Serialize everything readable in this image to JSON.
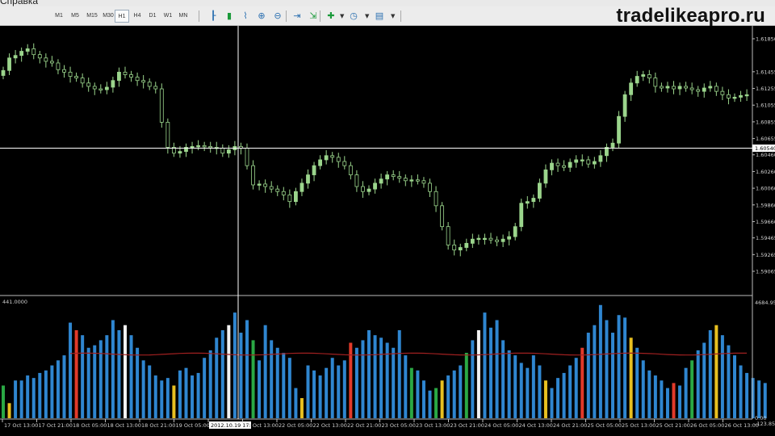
{
  "menu": {
    "partial_label": "Справка"
  },
  "watermark": "tradelikeapro.ru",
  "toolbar": {
    "timeframes": [
      "M1",
      "M5",
      "M15",
      "M30",
      "H1",
      "H4",
      "D1",
      "W1",
      "MN"
    ],
    "active_timeframe": "H1",
    "icons": [
      "bar-chart-icon",
      "candlestick-chart-icon",
      "line-chart-icon",
      "zoom-in-icon",
      "zoom-out-icon",
      "chart-shift-icon",
      "autoscroll-icon",
      "indicators-icon",
      "periods-icon",
      "templates-icon"
    ]
  },
  "colors": {
    "background": "#000000",
    "candle_up": "#9bd58c",
    "candle_down": "#000000",
    "candle_wick": "#9bd58c",
    "grid_frame": "#bdbdbd",
    "crosshair": "#ffffff",
    "volume_blue": "#2f86d0",
    "volume_red": "#e23a2a",
    "volume_green": "#2aa844",
    "volume_white": "#f2f2f2",
    "volume_yellow": "#e8c020",
    "volume_ma": "#a02020"
  },
  "price_axis": {
    "ticks": [
      "1.61850",
      "1.61455",
      "1.61255",
      "1.61055",
      "1.60855",
      "1.60655",
      "1.60540",
      "1.60460",
      "1.60260",
      "1.60060",
      "1.59860",
      "1.59660",
      "1.59465",
      "1.59265",
      "1.59065"
    ],
    "crosshair_label": "1.60540"
  },
  "volume_panel": {
    "left_label": "441.0000",
    "top_label": "4684.95",
    "bottom_labels": [
      "0.00",
      "-123.85"
    ]
  },
  "time_axis": {
    "labels": [
      "17 Oct 13:00",
      "17 Oct 21:00",
      "18 Oct 05:00",
      "18 Oct 13:00",
      "18 Oct 21:00",
      "19 Oct 05:00",
      "2012.10.19 17:00",
      "20 Oct 13:00",
      "22 Oct 05:00",
      "22 Oct 13:00",
      "22 Oct 21:00",
      "23 Oct 05:00",
      "23 Oct 13:00",
      "23 Oct 21:00",
      "24 Oct 05:00",
      "24 Oct 13:00",
      "24 Oct 21:00",
      "25 Oct 05:00",
      "25 Oct 13:00",
      "25 Oct 21:00",
      "26 Oct 05:00",
      "26 Oct 13:00"
    ],
    "highlighted_label": "2012.10.19 17:00"
  },
  "chart_data": {
    "type": "candlestick",
    "timeframe": "H1",
    "price_range": [
      1.59065,
      1.6185
    ],
    "crosshair_price": 1.6054,
    "close_series": [
      1.6147,
      1.6162,
      1.6165,
      1.617,
      1.6173,
      1.6166,
      1.6162,
      1.6158,
      1.6156,
      1.6148,
      1.6145,
      1.614,
      1.6138,
      1.6132,
      1.6128,
      1.6125,
      1.6124,
      1.6127,
      1.6135,
      1.6145,
      1.6142,
      1.6139,
      1.6135,
      1.6133,
      1.6128,
      1.6125,
      1.6085,
      1.6055,
      1.6048,
      1.605,
      1.6055,
      1.6056,
      1.6057,
      1.6056,
      1.6055,
      1.6054,
      1.6048,
      1.6052,
      1.6056,
      1.6054,
      1.6033,
      1.601,
      1.6011,
      1.6008,
      1.6005,
      1.6002,
      1.5998,
      1.599,
      1.6002,
      1.6012,
      1.6022,
      1.6033,
      1.604,
      1.6045,
      1.6043,
      1.6038,
      1.6033,
      1.6022,
      1.6008,
      1.6002,
      1.6005,
      1.6012,
      1.6017,
      1.6022,
      1.602,
      1.6018,
      1.6015,
      1.6016,
      1.6015,
      1.6012,
      1.6002,
      1.5985,
      1.596,
      1.5938,
      1.5932,
      1.5935,
      1.594,
      1.5945,
      1.5946,
      1.5946,
      1.5944,
      1.5942,
      1.5945,
      1.5948,
      1.596,
      1.5988,
      1.599,
      1.5994,
      1.6012,
      1.6028,
      1.6036,
      1.6033,
      1.6031,
      1.6037,
      1.604,
      1.604,
      1.6035,
      1.6038,
      1.6045,
      1.6055,
      1.606,
      1.6092,
      1.6118,
      1.6132,
      1.614,
      1.6142,
      1.6138,
      1.6128,
      1.6126,
      1.6128,
      1.6125,
      1.6128,
      1.6126,
      1.6124,
      1.6122,
      1.6126,
      1.6128,
      1.6122,
      1.6118,
      1.6114,
      1.6115,
      1.6117,
      1.6118
    ],
    "volume_range": [
      0,
      4684.95
    ],
    "volume_colors": [
      "green",
      "yellow",
      "blue",
      "blue",
      "blue",
      "blue",
      "blue",
      "blue",
      "blue",
      "blue",
      "blue",
      "blue",
      "red",
      "blue",
      "blue",
      "blue",
      "blue",
      "blue",
      "blue",
      "blue",
      "white",
      "blue",
      "blue",
      "blue",
      "blue",
      "blue",
      "blue",
      "blue",
      "yellow",
      "blue",
      "blue",
      "blue",
      "blue",
      "blue",
      "blue",
      "blue",
      "blue",
      "white",
      "blue",
      "blue",
      "blue",
      "green",
      "blue",
      "blue",
      "blue",
      "blue",
      "blue",
      "blue",
      "blue",
      "yellow",
      "blue",
      "blue",
      "blue",
      "blue",
      "blue",
      "blue",
      "blue",
      "red",
      "blue",
      "blue",
      "blue",
      "blue",
      "blue",
      "blue",
      "blue",
      "blue",
      "blue",
      "green",
      "blue",
      "blue",
      "blue",
      "green",
      "yellow",
      "blue",
      "blue",
      "blue",
      "green",
      "blue",
      "white",
      "blue",
      "blue",
      "blue",
      "blue",
      "blue",
      "blue",
      "blue",
      "blue",
      "blue",
      "blue",
      "yellow",
      "blue",
      "blue",
      "blue",
      "blue",
      "blue",
      "red",
      "blue",
      "blue",
      "blue",
      "blue",
      "blue",
      "blue",
      "blue",
      "yellow",
      "blue",
      "blue",
      "blue",
      "blue",
      "blue",
      "blue",
      "red",
      "blue",
      "blue",
      "green",
      "blue",
      "blue",
      "blue",
      "yellow",
      "blue",
      "blue",
      "blue",
      "blue",
      "blue",
      "blue"
    ],
    "volume_values": [
      1300,
      600,
      1500,
      1500,
      1700,
      1600,
      1800,
      1900,
      2100,
      2300,
      2500,
      3800,
      3500,
      3300,
      2800,
      2900,
      3100,
      3300,
      3900,
      3500,
      3700,
      3300,
      2800,
      2300,
      2100,
      1700,
      1500,
      1600,
      1300,
      1900,
      2000,
      1700,
      1800,
      2400,
      2700,
      3200,
      3500,
      3700,
      4200,
      3400,
      3900,
      3100,
      2300,
      3700,
      3100,
      2800,
      2600,
      2400,
      1200,
      800,
      2100,
      1900,
      1700,
      2000,
      2400,
      2100,
      2300,
      3000,
      2800,
      3100,
      3500,
      3300,
      3200,
      3000,
      2800,
      3500,
      2500,
      2000,
      1900,
      1500,
      1100,
      1200,
      1500,
      1700,
      1900,
      2100,
      2600,
      3100,
      3500,
      4200,
      3600,
      3900,
      3100,
      2700,
      2500,
      2200,
      2000,
      2500,
      2100,
      1500,
      1200,
      1600,
      1800,
      2100,
      2400,
      2800,
      3400,
      3700,
      4500,
      3900,
      3400,
      4100,
      4000,
      3200,
      2800,
      2300,
      1900,
      1700,
      1500,
      1200,
      1400,
      1300,
      2000,
      2300,
      2700,
      3000,
      3500,
      3700,
      3300,
      2900,
      2500,
      2100,
      1800,
      1600,
      1500,
      1400
    ],
    "volume_ma_level": 2550
  }
}
